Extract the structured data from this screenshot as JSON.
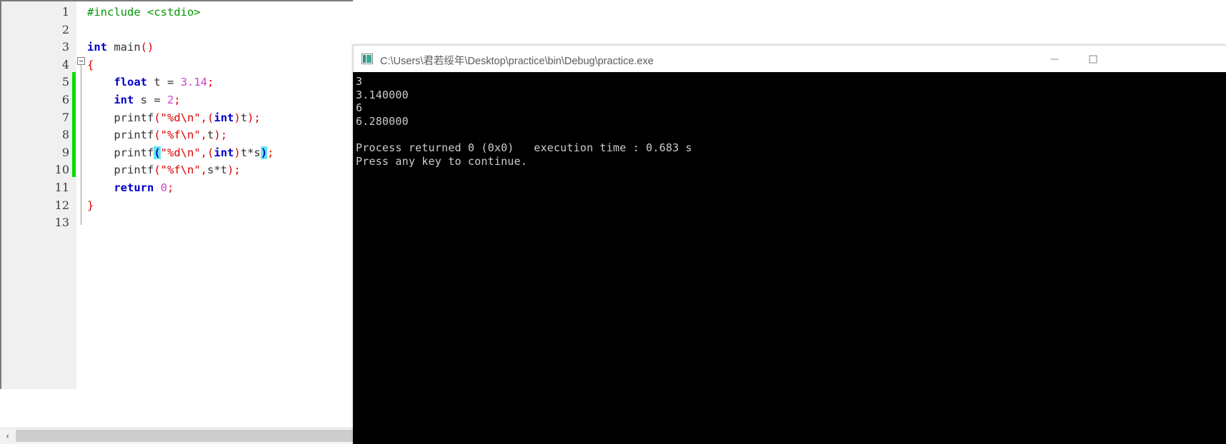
{
  "editor": {
    "name": "code-editor",
    "language": "C",
    "line_numbers": [
      "1",
      "2",
      "3",
      "4",
      "5",
      "6",
      "7",
      "8",
      "9",
      "10",
      "11",
      "12",
      "13"
    ],
    "fold_marker": "minus",
    "change_bar_lines": [
      5,
      6,
      7,
      8,
      9,
      10
    ],
    "lines": [
      {
        "n": 1,
        "tokens": [
          {
            "t": "#include <cstdio>",
            "c": "pre"
          }
        ]
      },
      {
        "n": 2,
        "tokens": []
      },
      {
        "n": 3,
        "tokens": [
          {
            "t": "int",
            "c": "kw"
          },
          {
            "t": " main",
            "c": "plain"
          },
          {
            "t": "()",
            "c": "punc"
          }
        ]
      },
      {
        "n": 4,
        "tokens": [
          {
            "t": "{",
            "c": "brace"
          }
        ]
      },
      {
        "n": 5,
        "tokens": [
          {
            "t": "    ",
            "c": "plain"
          },
          {
            "t": "float",
            "c": "kw"
          },
          {
            "t": " t ",
            "c": "plain"
          },
          {
            "t": "=",
            "c": "plain"
          },
          {
            "t": " ",
            "c": "plain"
          },
          {
            "t": "3.14",
            "c": "num"
          },
          {
            "t": ";",
            "c": "punc"
          }
        ]
      },
      {
        "n": 6,
        "tokens": [
          {
            "t": "    ",
            "c": "plain"
          },
          {
            "t": "int",
            "c": "kw"
          },
          {
            "t": " s ",
            "c": "plain"
          },
          {
            "t": "=",
            "c": "plain"
          },
          {
            "t": " ",
            "c": "plain"
          },
          {
            "t": "2",
            "c": "num"
          },
          {
            "t": ";",
            "c": "punc"
          }
        ]
      },
      {
        "n": 7,
        "tokens": [
          {
            "t": "    printf",
            "c": "plain"
          },
          {
            "t": "(",
            "c": "punc"
          },
          {
            "t": "\"%d\\n\"",
            "c": "str"
          },
          {
            "t": ",",
            "c": "punc"
          },
          {
            "t": "(",
            "c": "punc"
          },
          {
            "t": "int",
            "c": "kw"
          },
          {
            "t": ")",
            "c": "punc"
          },
          {
            "t": "t",
            "c": "plain"
          },
          {
            "t": ")",
            "c": "punc"
          },
          {
            "t": ";",
            "c": "punc"
          }
        ]
      },
      {
        "n": 8,
        "tokens": [
          {
            "t": "    printf",
            "c": "plain"
          },
          {
            "t": "(",
            "c": "punc"
          },
          {
            "t": "\"%f\\n\"",
            "c": "str"
          },
          {
            "t": ",",
            "c": "punc"
          },
          {
            "t": "t",
            "c": "plain"
          },
          {
            "t": ")",
            "c": "punc"
          },
          {
            "t": ";",
            "c": "punc"
          }
        ]
      },
      {
        "n": 9,
        "tokens": [
          {
            "t": "    printf",
            "c": "plain"
          },
          {
            "t": "(",
            "c": "hl"
          },
          {
            "t": "\"%d\\n\"",
            "c": "str"
          },
          {
            "t": ",",
            "c": "punc"
          },
          {
            "t": "(",
            "c": "punc"
          },
          {
            "t": "int",
            "c": "kw"
          },
          {
            "t": ")",
            "c": "punc"
          },
          {
            "t": "t*s",
            "c": "plain"
          },
          {
            "t": ")",
            "c": "hl"
          },
          {
            "t": ";",
            "c": "punc"
          }
        ]
      },
      {
        "n": 10,
        "tokens": [
          {
            "t": "    printf",
            "c": "plain"
          },
          {
            "t": "(",
            "c": "punc"
          },
          {
            "t": "\"%f\\n\"",
            "c": "str"
          },
          {
            "t": ",",
            "c": "punc"
          },
          {
            "t": "s*t",
            "c": "plain"
          },
          {
            "t": ")",
            "c": "punc"
          },
          {
            "t": ";",
            "c": "punc"
          }
        ]
      },
      {
        "n": 11,
        "tokens": [
          {
            "t": "    ",
            "c": "plain"
          },
          {
            "t": "return",
            "c": "kw"
          },
          {
            "t": " ",
            "c": "plain"
          },
          {
            "t": "0",
            "c": "num"
          },
          {
            "t": ";",
            "c": "punc"
          }
        ]
      },
      {
        "n": 12,
        "tokens": [
          {
            "t": "}",
            "c": "brace"
          }
        ]
      },
      {
        "n": 13,
        "tokens": []
      }
    ],
    "hscrollbar": {
      "left_arrow": "‹"
    }
  },
  "console": {
    "title": "C:\\Users\\君若绥年\\Desktop\\practice\\bin\\Debug\\practice.exe",
    "icon": "console-window-icon",
    "window_buttons": {
      "minimize": "minimize",
      "maximize": "maximize"
    },
    "output_lines": [
      "3",
      "3.140000",
      "6",
      "6.280000",
      "",
      "Process returned 0 (0x0)   execution time : 0.683 s",
      "Press any key to continue."
    ],
    "background_color": "#000000",
    "text_color": "#cccccc"
  }
}
